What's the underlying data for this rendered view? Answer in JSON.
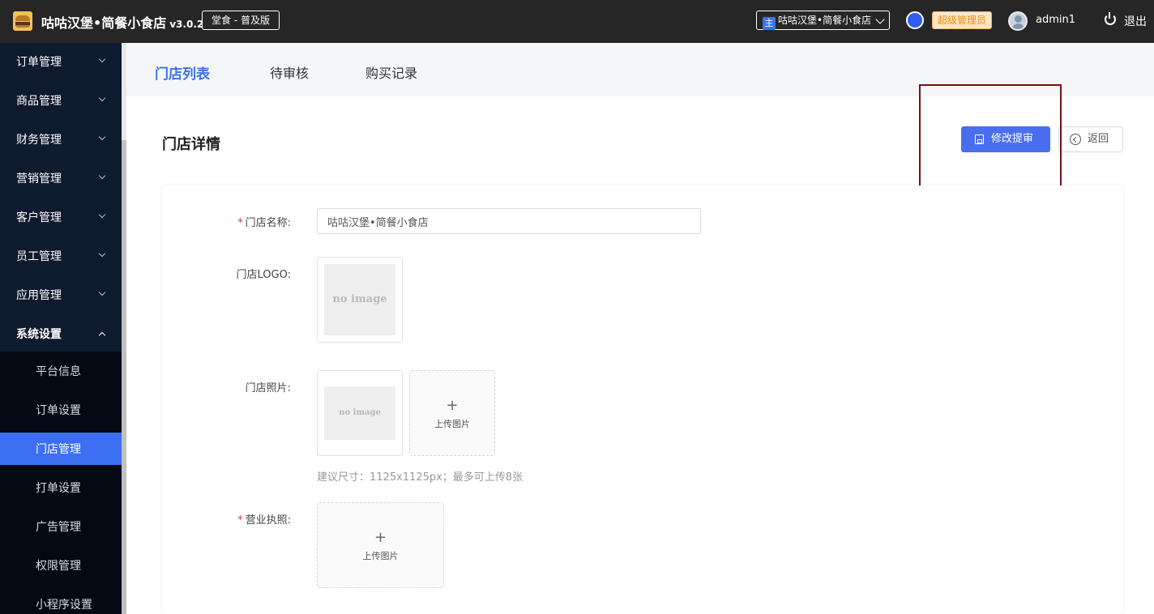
{
  "header": {
    "app_title": "咕咕汉堡•简餐小食店",
    "version": "v3.0.2",
    "edition": "堂食 - 普及版",
    "store_select": {
      "badge": "主",
      "value": "咕咕汉堡•简餐小食店"
    },
    "role": "超级管理员",
    "username": "admin1",
    "logout_label": "退出"
  },
  "sidebar": {
    "items": [
      {
        "label": "订单管理"
      },
      {
        "label": "商品管理"
      },
      {
        "label": "财务管理"
      },
      {
        "label": "营销管理"
      },
      {
        "label": "客户管理"
      },
      {
        "label": "员工管理"
      },
      {
        "label": "应用管理"
      },
      {
        "label": "系统设置"
      }
    ],
    "subitems": [
      {
        "label": "平台信息"
      },
      {
        "label": "订单设置"
      },
      {
        "label": "门店管理"
      },
      {
        "label": "打单设置"
      },
      {
        "label": "广告管理"
      },
      {
        "label": "权限管理"
      },
      {
        "label": "小程序设置"
      }
    ],
    "active_subitem": "门店管理"
  },
  "tabs": [
    {
      "label": "门店列表"
    },
    {
      "label": "待审核"
    },
    {
      "label": "购买记录"
    }
  ],
  "active_tab": "门店列表",
  "page": {
    "title": "门店详情",
    "submit_label": "修改提审",
    "back_label": "返回"
  },
  "form": {
    "name_label": "门店名称:",
    "name_value": "咕咕汉堡•简餐小食店",
    "logo_label": "门店LOGO:",
    "photos_label": "门店照片:",
    "no_image_text": "no image",
    "upload_label": "上传图片",
    "photo_hint": "建议尺寸：1125x1125px；最多可上传8张",
    "license_label": "营业执照:",
    "required_mark": "*"
  },
  "colors": {
    "accent": "#3d6ff2",
    "sidebar_bg": "#0e1a2d",
    "topbar_bg": "#262626",
    "highlight": "#7a0f12"
  }
}
